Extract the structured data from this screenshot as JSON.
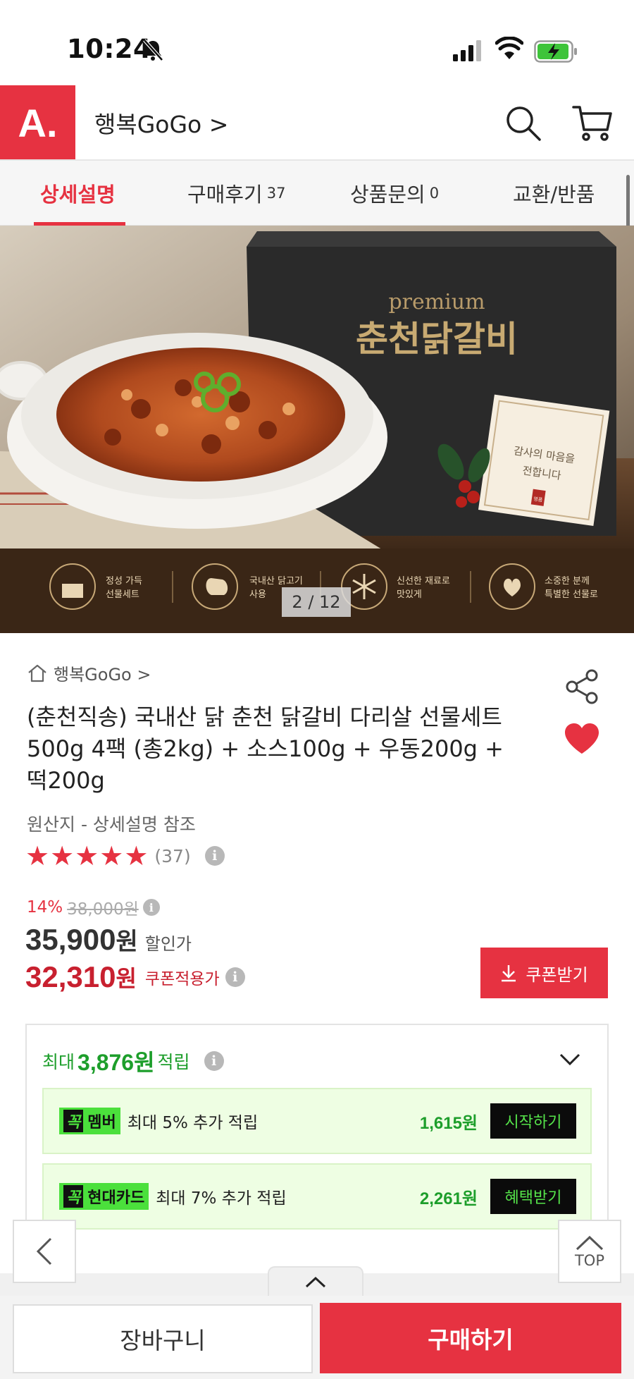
{
  "status_bar": {
    "time": "10:24"
  },
  "header": {
    "logo": "A.",
    "store_title": "행복GoGo >"
  },
  "tabs": [
    {
      "label": "상세설명",
      "count": ""
    },
    {
      "label": "구매후기",
      "count": "37"
    },
    {
      "label": "상품문의",
      "count": "0"
    },
    {
      "label": "교환/반품",
      "count": ""
    }
  ],
  "hero": {
    "bag_text_top": "premium",
    "bag_text_main": "춘천닭갈비",
    "card_text_1": "감사의 마음을",
    "card_text_2": "전합니다",
    "card_stamp": "명품",
    "features": [
      {
        "line1": "정성 가득",
        "line2": "선물세트"
      },
      {
        "line1": "국내산 닭고기",
        "line2": "사용"
      },
      {
        "line1": "신선한 재료로",
        "line2": "맛있게"
      },
      {
        "line1": "소중한 분께",
        "line2": "특별한 선물로"
      }
    ],
    "pager": "2 / 12"
  },
  "product": {
    "breadcrumb": "행복GoGo >",
    "title": "(춘천직송) 국내산 닭 춘천 닭갈비 다리살 선물세트 500g 4팩 (총2kg) + 소스100g + 우동200g + 떡200g",
    "origin": "원산지 - 상세설명 참조",
    "rating_stars": 5,
    "review_count": "(37)",
    "discount_rate": "14%",
    "original_price": "38,000원",
    "sale_price": "35,900",
    "sale_unit": "원",
    "sale_label": "할인가",
    "coupon_price": "32,310",
    "coupon_unit": "원",
    "coupon_label": "쿠폰적용가",
    "coupon_button": "쿠폰받기"
  },
  "points": {
    "prefix": "최대",
    "amount": "3,876원",
    "suffix": "적립",
    "benefits": [
      {
        "badge_k": "꼭",
        "badge": "멤버",
        "text": "최대 5% 추가 적립",
        "amount": "1,615원",
        "button": "시작하기"
      },
      {
        "badge_k": "꼭",
        "badge": "현대카드",
        "text": "최대 7% 추가 적립",
        "amount": "2,261원",
        "button": "혜택받기"
      }
    ]
  },
  "floating": {
    "top_label": "TOP"
  },
  "bottom_bar": {
    "cart": "장바구니",
    "buy": "구매하기"
  },
  "colors": {
    "accent": "#e63241",
    "points_green": "#1d9e2b",
    "badge_green": "#4be03c"
  }
}
